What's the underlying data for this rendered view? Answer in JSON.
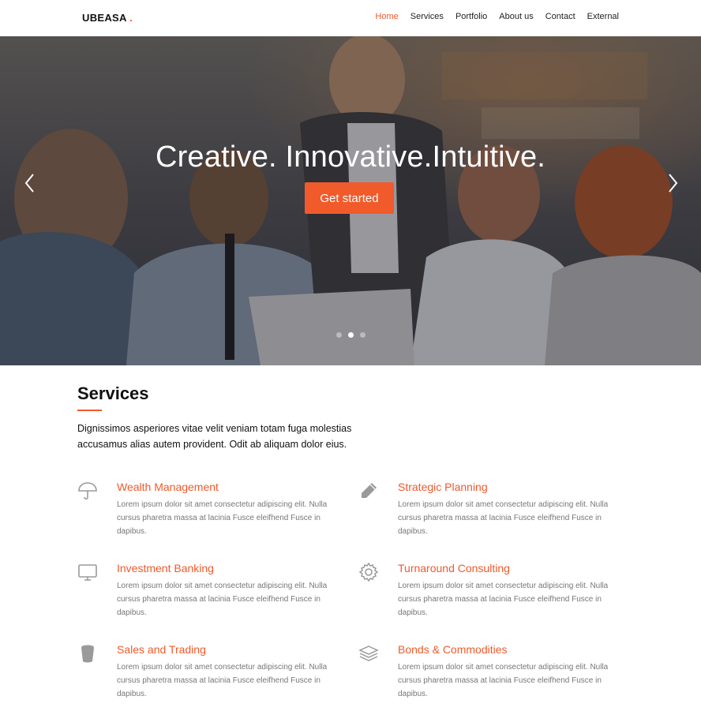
{
  "brand": {
    "name": "UBEASA",
    "dot": "."
  },
  "nav": {
    "items": [
      {
        "label": "Home",
        "active": true
      },
      {
        "label": "Services"
      },
      {
        "label": "Portfolio"
      },
      {
        "label": "About us"
      },
      {
        "label": "Contact"
      },
      {
        "label": "External"
      }
    ]
  },
  "hero": {
    "title": "Creative. Innovative.Intuitive.",
    "cta": "Get started",
    "prev_icon": "chevron-left-icon",
    "next_icon": "chevron-right-icon",
    "slides_count": 3,
    "active_slide": 2
  },
  "services": {
    "title": "Services",
    "intro": "Dignissimos asperiores vitae velit veniam totam fuga molestias accusamus alias autem provident. Odit ab aliquam dolor eius.",
    "items": [
      {
        "title": "Wealth Management",
        "icon": "umbrella-icon",
        "text": "Lorem ipsum dolor sit amet consectetur adipiscing elit. Nulla cursus pharetra massa at lacinia Fusce eleifhend Fusce in dapibus."
      },
      {
        "title": "Strategic Planning",
        "icon": "pencil-icon",
        "text": "Lorem ipsum dolor sit amet consectetur adipiscing elit. Nulla cursus pharetra massa at lacinia Fusce eleifhend Fusce in dapibus."
      },
      {
        "title": "Investment Banking",
        "icon": "monitor-icon",
        "text": "Lorem ipsum dolor sit amet consectetur adipiscing elit. Nulla cursus pharetra massa at lacinia Fusce eleifhend Fusce in dapibus."
      },
      {
        "title": "Turnaround Consulting",
        "icon": "gear-icon",
        "text": "Lorem ipsum dolor sit amet consectetur adipiscing elit. Nulla cursus pharetra massa at lacinia Fusce eleifhend Fusce in dapibus."
      },
      {
        "title": "Sales and Trading",
        "icon": "trash-can-icon",
        "text": "Lorem ipsum dolor sit amet consectetur adipiscing elit. Nulla cursus pharetra massa at lacinia Fusce eleifhend Fusce in dapibus."
      },
      {
        "title": "Bonds & Commodities",
        "icon": "layers-icon",
        "text": "Lorem ipsum dolor sit amet consectetur adipiscing elit. Nulla cursus pharetra massa at lacinia Fusce eleifhend Fusce in dapibus."
      }
    ]
  },
  "colors": {
    "accent": "#f15a2b",
    "text": "#111111",
    "muted": "#777777",
    "icon": "#9a9a9a"
  }
}
